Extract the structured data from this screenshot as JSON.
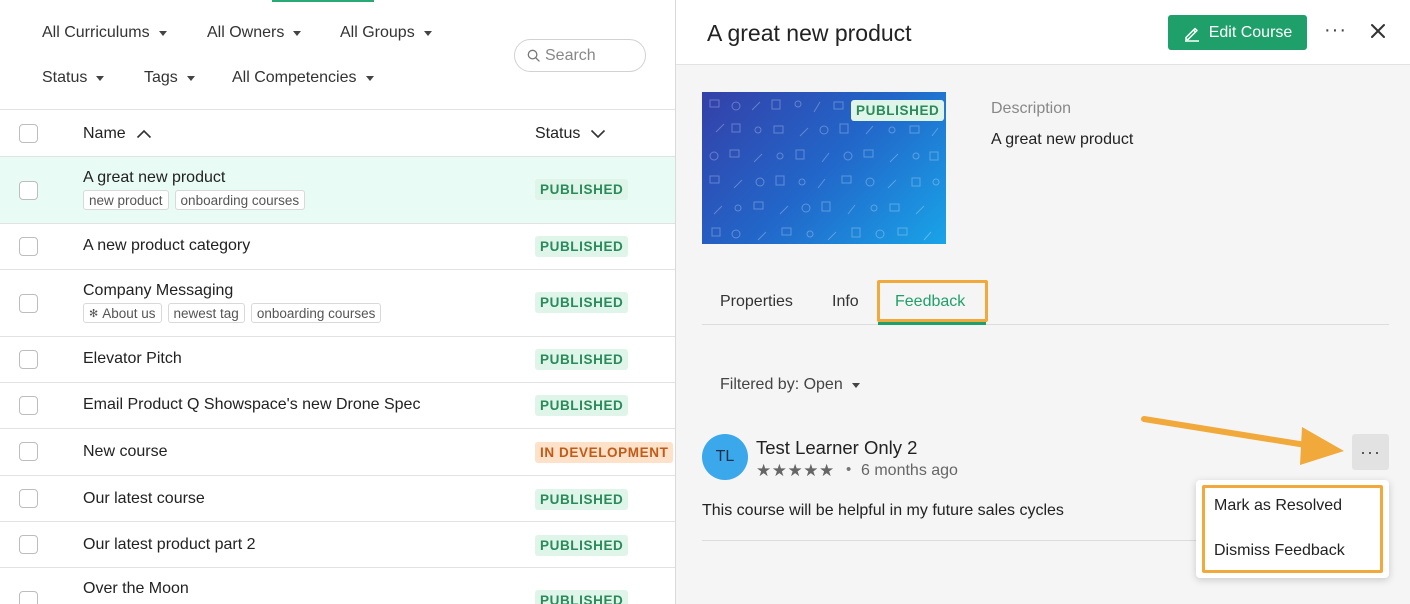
{
  "filters": {
    "curriculums": "All Curriculums",
    "owners": "All Owners",
    "groups": "All Groups",
    "status": "Status",
    "tags": "Tags",
    "competencies": "All Competencies",
    "search_placeholder": "Search"
  },
  "table": {
    "col_name": "Name",
    "col_status": "Status",
    "rows": [
      {
        "name": "A great new product",
        "tags": [
          "new product",
          "onboarding courses"
        ],
        "status": "PUBLISHED"
      },
      {
        "name": "A new product category",
        "tags": [],
        "status": "PUBLISHED"
      },
      {
        "name": "Company Messaging",
        "tags": [
          "About us",
          "newest tag",
          "onboarding courses"
        ],
        "status": "PUBLISHED"
      },
      {
        "name": "Elevator Pitch",
        "tags": [],
        "status": "PUBLISHED"
      },
      {
        "name": "Email Product Q Showspace's new Drone Spec",
        "tags": [],
        "status": "PUBLISHED"
      },
      {
        "name": "New course",
        "tags": [],
        "status": "IN DEVELOPMENT"
      },
      {
        "name": "Our latest course",
        "tags": [],
        "status": "PUBLISHED"
      },
      {
        "name": "Our latest product part 2",
        "tags": [],
        "status": "PUBLISHED"
      },
      {
        "name": "Over the Moon",
        "tags": [],
        "status": "PUBLISHED"
      }
    ]
  },
  "detail": {
    "title": "A great new product",
    "edit_label": "Edit Course",
    "more_label": "···",
    "thumb_badge": "PUBLISHED",
    "desc_label": "Description",
    "desc_text": "A great new product",
    "tabs": [
      "Properties",
      "Info",
      "Feedback"
    ],
    "active_tab": "Feedback",
    "filter_label": "Filtered by: Open",
    "feedback": {
      "initials": "TL",
      "name": "Test Learner Only 2",
      "stars": "★★★★★",
      "dot": "•",
      "time": "6 months ago",
      "text": "This course will be helpful in my future sales cycles",
      "more_label": "···"
    },
    "menu": [
      "Mark as Resolved",
      "Dismiss Feedback"
    ]
  },
  "colors": {
    "accent_green": "#1fa06a",
    "published_bg": "#dff5ea",
    "published_fg": "#2a8a5a",
    "dev_bg": "#fde1c9",
    "dev_fg": "#c25a18",
    "highlight_orange": "#f2a93b",
    "avatar_blue": "#3aa8ea"
  }
}
